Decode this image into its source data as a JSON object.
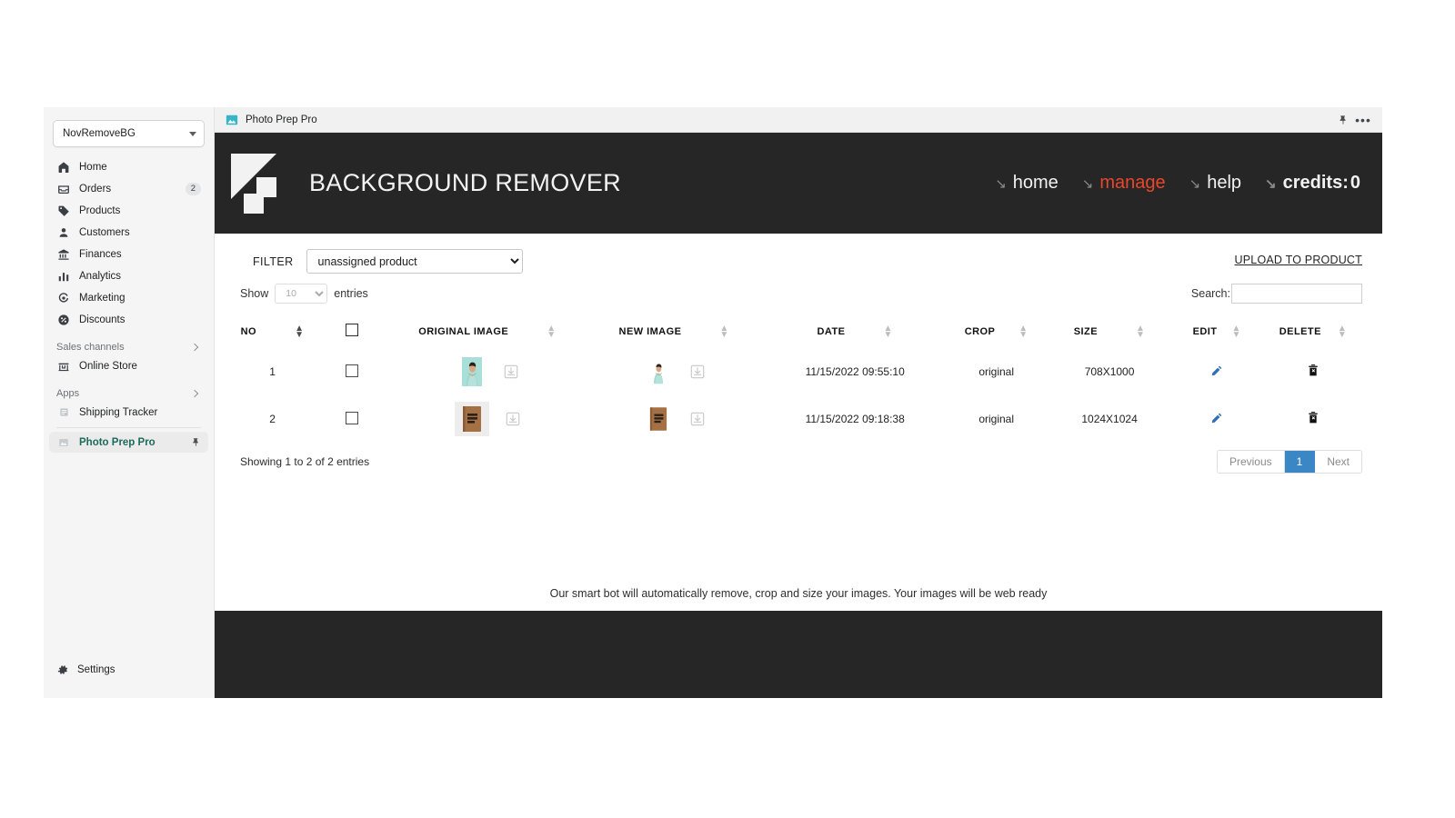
{
  "window": {
    "titlebar": {
      "app_icon": "photo-app-icon",
      "title": "Photo Prep Pro",
      "pin_icon": "pin-icon",
      "more_icon": "more-options-icon"
    }
  },
  "sidebar": {
    "store_selector": {
      "label": "NovRemoveBG",
      "caret_icon": "chevron-down-icon"
    },
    "items": [
      {
        "label": "Home",
        "icon": "home-icon",
        "badge": ""
      },
      {
        "label": "Orders",
        "icon": "orders-icon",
        "badge": "2"
      },
      {
        "label": "Products",
        "icon": "products-tag-icon",
        "badge": ""
      },
      {
        "label": "Customers",
        "icon": "customers-person-icon",
        "badge": ""
      },
      {
        "label": "Finances",
        "icon": "finances-bank-icon",
        "badge": ""
      },
      {
        "label": "Analytics",
        "icon": "analytics-bars-icon",
        "badge": ""
      },
      {
        "label": "Marketing",
        "icon": "marketing-target-icon",
        "badge": ""
      },
      {
        "label": "Discounts",
        "icon": "discounts-percent-icon",
        "badge": ""
      }
    ],
    "sales_channels": {
      "title": "Sales channels",
      "chevron_icon": "chevron-right-icon",
      "items": [
        {
          "label": "Online Store",
          "icon": "store-icon"
        }
      ]
    },
    "apps": {
      "title": "Apps",
      "chevron_icon": "chevron-right-icon",
      "items": [
        {
          "label": "Shipping Tracker",
          "icon": "shipping-app-icon",
          "pinned": false
        },
        {
          "label": "Photo Prep Pro",
          "icon": "photo-app-icon",
          "pinned": true,
          "pin_icon": "pin-icon"
        }
      ]
    },
    "settings": {
      "label": "Settings",
      "icon": "gear-icon"
    }
  },
  "app_header": {
    "logo_icon": "background-remover-logo",
    "title": "BACKGROUND REMOVER",
    "nav": [
      {
        "label": "home",
        "arrow_icon": "arrow-down-right-icon",
        "active": false
      },
      {
        "label": "manage",
        "arrow_icon": "arrow-down-right-icon",
        "active": true
      },
      {
        "label": "help",
        "arrow_icon": "arrow-down-right-icon",
        "active": false
      }
    ],
    "credits": {
      "label": "credits:",
      "value": "0",
      "arrow_icon": "arrow-down-right-icon"
    },
    "colors": {
      "background": "#262626",
      "accent": "#e8472b",
      "text": "#f2f2f2"
    }
  },
  "toolbar": {
    "filter_label": "FILTER",
    "filter_value": "unassigned product",
    "filter_options": [
      "unassigned product"
    ],
    "upload_link": "UPLOAD TO PRODUCT",
    "show_label": "Show",
    "show_value": "10",
    "show_options": [
      "10"
    ],
    "entries_label": "entries",
    "search_label": "Search:",
    "search_value": "",
    "search_placeholder": ""
  },
  "table": {
    "columns": [
      {
        "label": "NO",
        "sort_icon": "sort-ascending-icon",
        "sorted": true
      },
      {
        "label": "",
        "sort_icon": "",
        "sorted": false
      },
      {
        "label": "ORIGINAL IMAGE",
        "sort_icon": "sort-both-icon",
        "sorted": false
      },
      {
        "label": "NEW IMAGE",
        "sort_icon": "sort-both-icon",
        "sorted": false
      },
      {
        "label": "DATE",
        "sort_icon": "sort-both-icon",
        "sorted": false
      },
      {
        "label": "CROP",
        "sort_icon": "sort-both-icon",
        "sorted": false
      },
      {
        "label": "SIZE",
        "sort_icon": "sort-both-icon",
        "sorted": false
      },
      {
        "label": "EDIT",
        "sort_icon": "sort-both-icon",
        "sorted": false
      },
      {
        "label": "DELETE",
        "sort_icon": "sort-both-icon",
        "sorted": false
      }
    ],
    "rows": [
      {
        "no": "1",
        "original_alt": "man-in-mint-tshirt-on-teal-background",
        "new_alt": "man-in-mint-tshirt-transparent-background",
        "date": "11/15/2022 09:55:10",
        "crop": "original",
        "size": "708X1000",
        "edit_icon": "pencil-icon",
        "delete_icon": "trash-icon",
        "download_icon": "download-icon"
      },
      {
        "no": "2",
        "original_alt": "brown-notebook-cover-on-white-background",
        "new_alt": "brown-notebook-cover-transparent-background",
        "date": "11/15/2022 09:18:38",
        "crop": "original",
        "size": "1024X1024",
        "edit_icon": "pencil-icon",
        "delete_icon": "trash-icon",
        "download_icon": "download-icon"
      }
    ],
    "footer_text": "Showing 1 to 2 of 2 entries",
    "pagination": {
      "previous": "Previous",
      "pages": [
        "1"
      ],
      "active_page": "1",
      "next": "Next"
    }
  },
  "tagline": "Our smart bot will automatically remove, crop and size your images. Your images will be web ready"
}
